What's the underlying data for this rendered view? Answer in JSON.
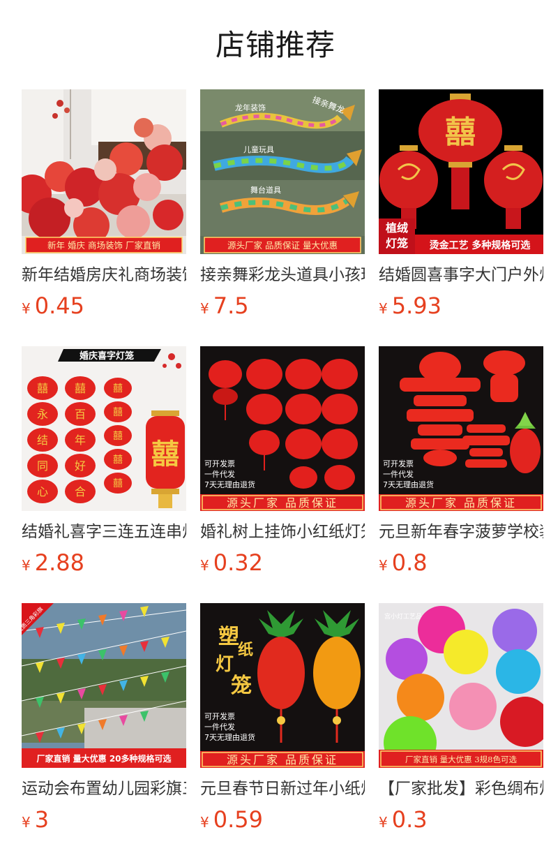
{
  "page": {
    "title": "店铺推荐"
  },
  "colors": {
    "price": "#e6401f",
    "banner": "#e02020",
    "banner_text": "#ffe9a8"
  },
  "products": [
    {
      "name": "新年结婚房庆礼商场装饰纸灯笼",
      "currency": "¥",
      "price": "0.45",
      "banner": "新年 婚庆 商场装饰 厂家直销"
    },
    {
      "name": "接亲舞彩龙头道具小孩玩具",
      "currency": "¥",
      "price": "7.5",
      "banner": "源头厂家 品质保证 量大优惠",
      "overlay": [
        "龙年装饰",
        "接亲舞龙",
        "儿童玩具",
        "舞台道具"
      ]
    },
    {
      "name": "结婚圆喜事字大门户外灯笼",
      "currency": "¥",
      "price": "5.93",
      "banner_left": "植绒 灯笼",
      "banner": "烫金工艺 多种规格可选",
      "lantern_char": "囍"
    },
    {
      "name": "结婚礼喜字三连五连串灯笼",
      "currency": "¥",
      "price": "2.88",
      "header": "婚庆喜字灯笼",
      "chars": [
        [
          "囍",
          "永",
          "结",
          "同",
          "心"
        ],
        [
          "囍",
          "百",
          "年",
          "好",
          "合"
        ],
        [
          "囍",
          "囍",
          "囍",
          "囍",
          "囍"
        ]
      ],
      "big_char": "囍"
    },
    {
      "name": "婚礼树上挂饰小红纸灯笼串",
      "currency": "¥",
      "price": "0.32",
      "notes": [
        "可开发票",
        "一件代发",
        "7天无理由退货"
      ],
      "banner": "源头厂家 品质保证"
    },
    {
      "name": "元旦新年春字菠萝学校装饰",
      "currency": "¥",
      "price": "0.8",
      "notes": [
        "可开发票",
        "一件代发",
        "7天无理由退货"
      ],
      "banner": "源头厂家 品质保证",
      "spring_char": "春"
    },
    {
      "name": "运动会布置幼儿园彩旗三角旗",
      "currency": "¥",
      "price": "3",
      "ribbon": "优质三角彩旗",
      "banner": "厂家直销 量大优惠 20多种规格可选"
    },
    {
      "name": "元旦春节日新过年小纸灯笼",
      "currency": "¥",
      "price": "0.59",
      "headline": "塑纸灯笼",
      "notes": [
        "可开发票",
        "一件代发",
        "7天无理由退货"
      ],
      "banner": "源头厂家 品质保证"
    },
    {
      "name": "【厂家批发】彩色绸布灯笼",
      "currency": "¥",
      "price": "0.3",
      "watermark": "宫小灯工艺品",
      "banner": "厂家直销 量大优惠 3规8色可选"
    }
  ]
}
